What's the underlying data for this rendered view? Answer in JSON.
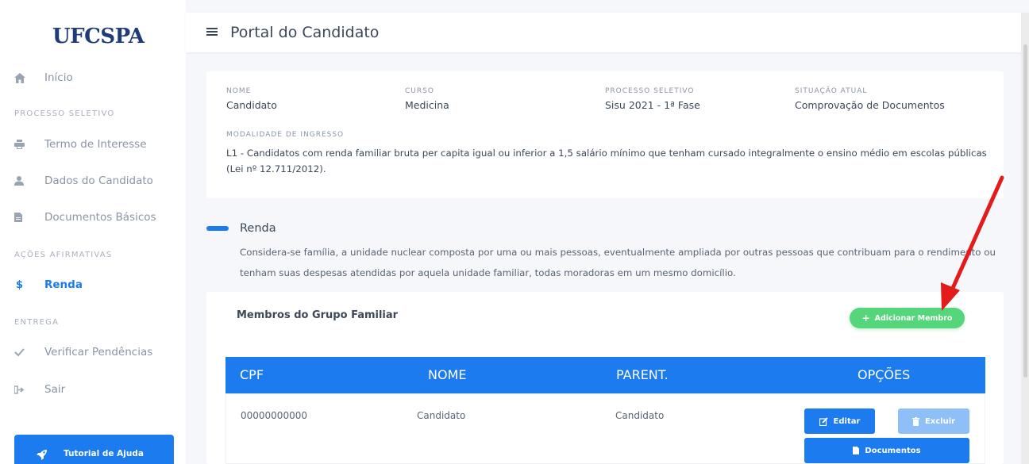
{
  "sidebar": {
    "logo": "UFCSPA",
    "items": {
      "inicio": "Início",
      "termo": "Termo de Interesse",
      "dados": "Dados do Candidato",
      "documentos": "Documentos Básicos",
      "renda": "Renda",
      "verificar": "Verificar Pendências",
      "sair": "Sair"
    },
    "sections": {
      "processo": "PROCESSO SELETIVO",
      "acoes": "AÇÕES AFIRMATIVAS",
      "entrega": "ENTREGA"
    },
    "tutorial": "Tutorial de Ajuda",
    "active_item": "renda"
  },
  "header": {
    "title": "Portal do Candidato"
  },
  "info": {
    "nome_label": "NOME",
    "nome": "Candidato",
    "curso_label": "CURSO",
    "curso": "Medicina",
    "processo_label": "PROCESSO SELETIVO",
    "processo": "Sisu 2021 - 1ª Fase",
    "situacao_label": "SITUAÇÃO ATUAL",
    "situacao": "Comprovação de Documentos",
    "modalidade_label": "MODALIDADE DE INGRESSO",
    "modalidade": "L1 - Candidatos com renda familiar bruta per capita igual ou inferior a 1,5 salário mínimo que tenham cursado integralmente o ensino médio em escolas públicas (Lei nº 12.711/2012)."
  },
  "renda": {
    "title": "Renda",
    "description": "Considera-se família, a unidade nuclear composta por uma ou mais pessoas, eventualmente ampliada por outras pessoas que contribuam para o rendimento ou tenham suas despesas atendidas por aquela unidade familiar, todas moradoras em um mesmo domicílio."
  },
  "members": {
    "title": "Membros do Grupo Familiar",
    "add_label": "Adicionar Membro",
    "columns": [
      "CPF",
      "NOME",
      "PARENT.",
      "OPÇÕES"
    ],
    "rows": [
      {
        "cpf": "00000000000",
        "nome": "Candidato",
        "parentesco": "Candidato",
        "edit_label": "Editar",
        "delete_label": "Excluir",
        "docs_label": "Documentos"
      }
    ]
  },
  "colors": {
    "primary": "#1b7bef",
    "success": "#55d67a",
    "annotation_arrow": "#e31b1b"
  }
}
